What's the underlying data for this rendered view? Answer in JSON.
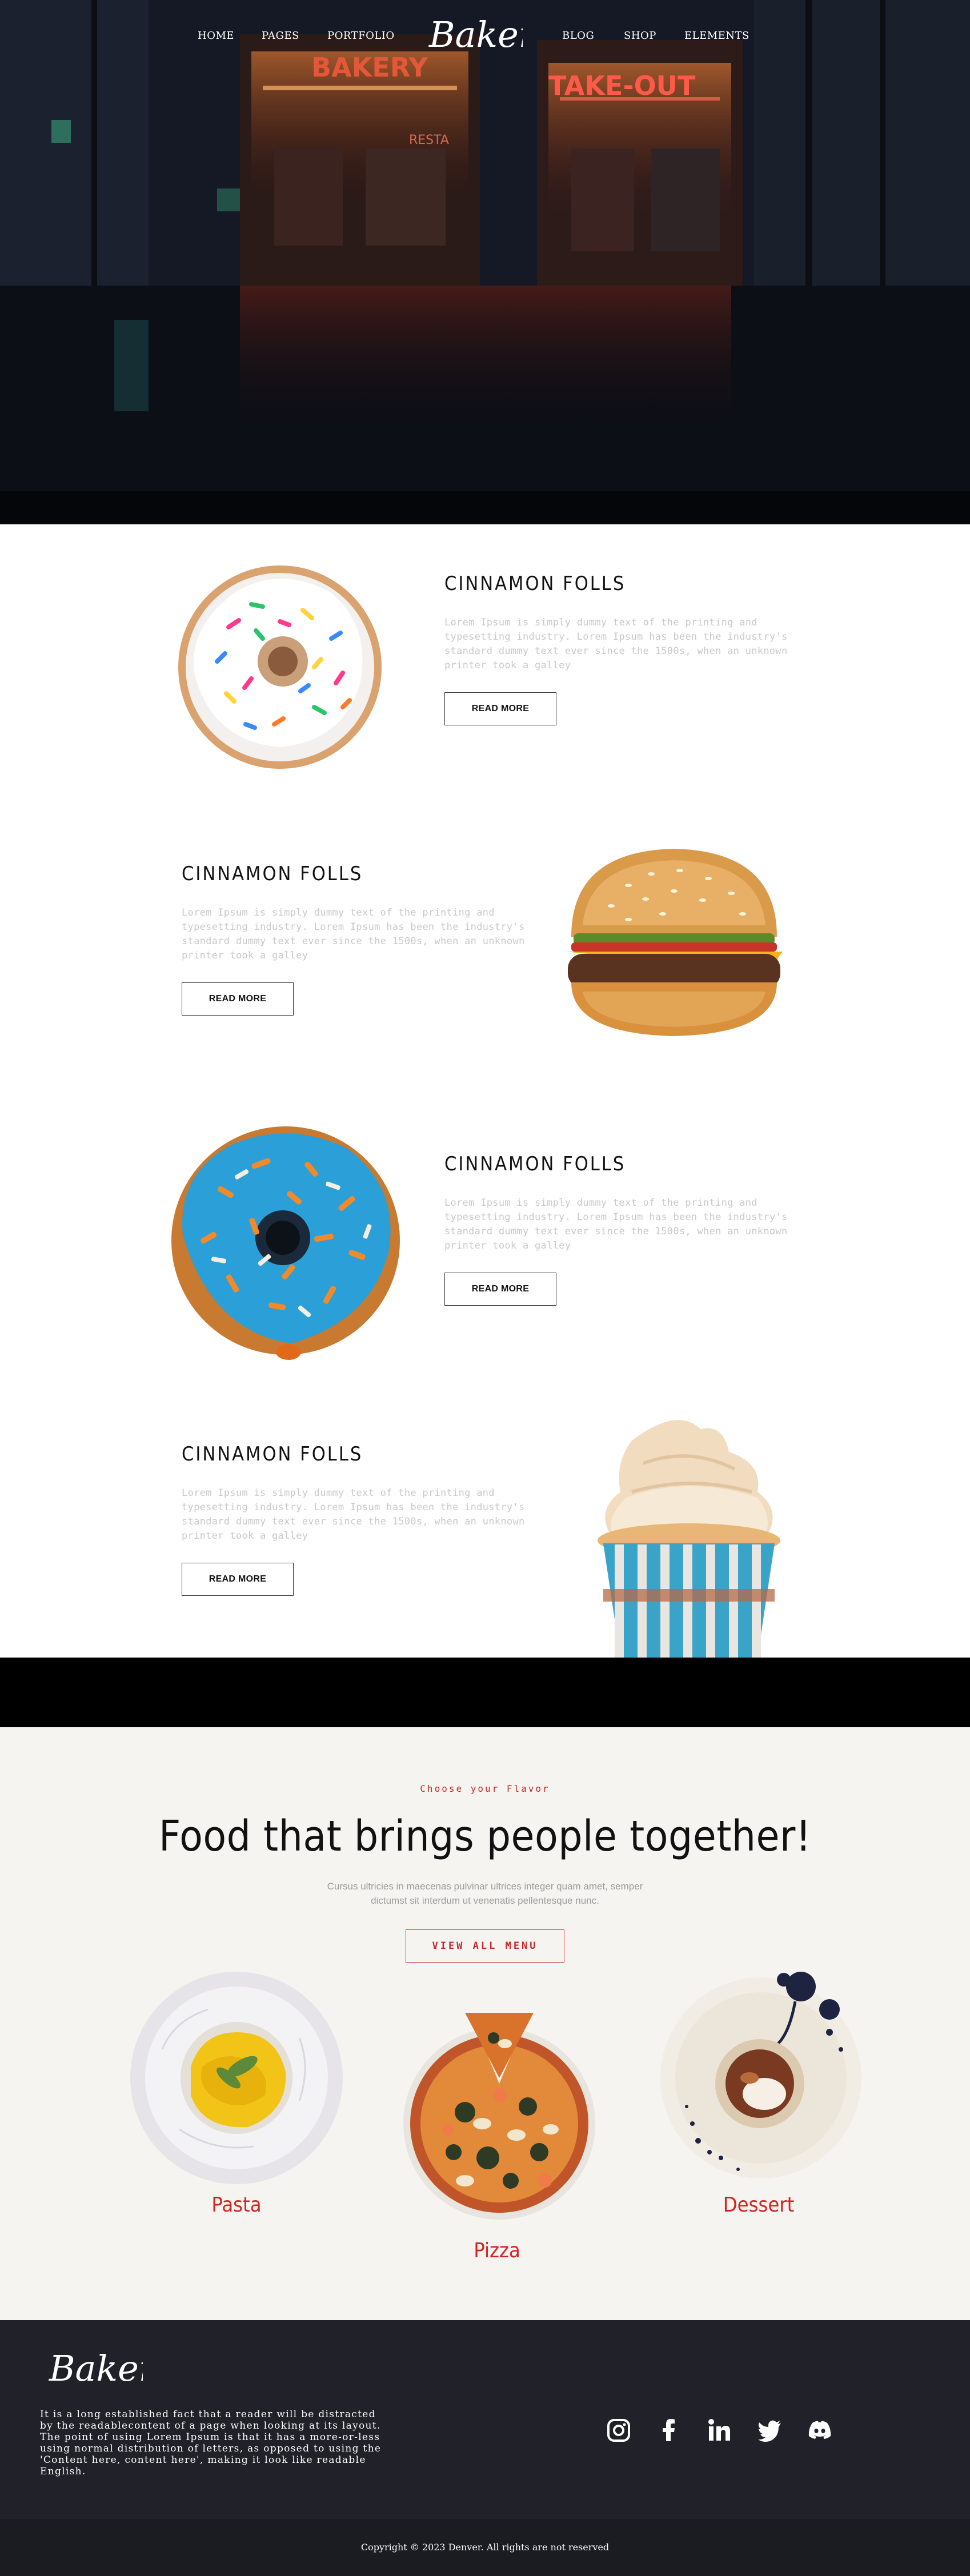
{
  "nav": {
    "items": [
      "HOME",
      "PAGES",
      "PORTFOLIO",
      "BLOG",
      "SHOP",
      "ELEMENTS"
    ],
    "logo": "Baker"
  },
  "hero": {
    "sign_left": "BAKERY",
    "sign_right": "TAKE-OUT",
    "sign_small": "RESTA"
  },
  "products": [
    {
      "title": "CINNAMON FOLLS",
      "body": "Lorem Ipsum is simply dummy text of the printing and typesetting industry. Lorem Ipsum has been the industry's standard dummy text ever since the 1500s, when an unknown printer took a galley",
      "button": "READ MORE",
      "image": "donut-sprinkles"
    },
    {
      "title": "CINNAMON FOLLS",
      "body": "Lorem Ipsum is simply dummy text of the printing and typesetting industry. Lorem Ipsum has been the industry's standard dummy text ever since the 1500s, when an unknown printer took a galley",
      "button": "READ MORE",
      "image": "burger"
    },
    {
      "title": "CINNAMON FOLLS",
      "body": "Lorem Ipsum is simply dummy text of the printing and typesetting industry. Lorem Ipsum has been the industry's standard dummy text ever since the 1500s, when an unknown printer took a galley",
      "button": "READ MORE",
      "image": "donut-blue"
    },
    {
      "title": "CINNAMON FOLLS",
      "body": "Lorem Ipsum is simply dummy text of the printing and typesetting industry. Lorem Ipsum has been the industry's standard dummy text ever since the 1500s, when an unknown printer took a galley",
      "button": "READ MORE",
      "image": "cupcake"
    }
  ],
  "menu": {
    "eyebrow": "Choose your Flavor",
    "title": "Food that brings people together!",
    "subtitle": "Cursus ultricies in maecenas pulvinar ultrices integer quam amet, semper dictumst sit interdum ut venenatis pellentesque nunc.",
    "button": "VIEW ALL MENU",
    "dishes": [
      "Pasta",
      "Pizza",
      "Dessert"
    ]
  },
  "footer": {
    "logo": "Baker",
    "text": "It is a long established fact that a reader will be distracted by the readablecontent of a page when looking at its layout. The point of using Lorem Ipsum is that it has a more-or-less using normal distribution of letters, as opposed to using the 'Content here, content here', making it look like readable English.",
    "socials": [
      "instagram-icon",
      "facebook-icon",
      "linkedin-icon",
      "twitter-icon",
      "discord-icon"
    ],
    "copyright": "Copyright © 2023 Denver. All rights are not reserved"
  },
  "colors": {
    "accent_red": "#d32323",
    "footer_bg": "#212229",
    "menu_bg": "#f6f4f1"
  }
}
